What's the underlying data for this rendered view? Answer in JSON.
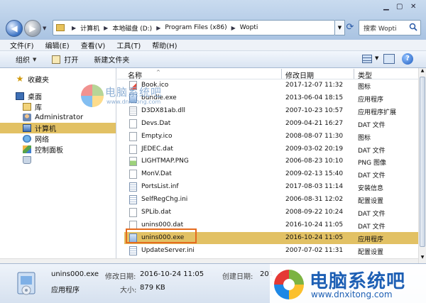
{
  "address": {
    "crumbs": [
      "计算机",
      "本地磁盘 (D:)",
      "Program Files (x86)",
      "Wopti"
    ]
  },
  "search": {
    "placeholder": "搜索 Wopti"
  },
  "menu": [
    "文件(F)",
    "编辑(E)",
    "查看(V)",
    "工具(T)",
    "帮助(H)"
  ],
  "toolbar": {
    "organize": "组织",
    "open": "打开",
    "new_folder": "新建文件夹"
  },
  "sidebar": {
    "favorites": "收藏夹",
    "desktop": "桌面",
    "library": "库",
    "user": "Administrator",
    "computer": "计算机",
    "network": "网络",
    "control_panel": "控制面板"
  },
  "columns": {
    "name": "名称",
    "date": "修改日期",
    "type": "类型"
  },
  "files": [
    {
      "name": "Book.ico",
      "date": "2017-12-07 11:32",
      "type": "图标",
      "icon": "ico"
    },
    {
      "name": "bundle.exe",
      "date": "2013-06-04 18:15",
      "type": "应用程序",
      "icon": "exe"
    },
    {
      "name": "D3DX81ab.dll",
      "date": "2007-10-23 10:57",
      "type": "应用程序扩展",
      "icon": "dll"
    },
    {
      "name": "Devs.Dat",
      "date": "2009-04-21 16:27",
      "type": "DAT 文件",
      "icon": "dat"
    },
    {
      "name": "Empty.ico",
      "date": "2008-08-07 11:30",
      "type": "图标",
      "icon": "blank"
    },
    {
      "name": "JEDEC.dat",
      "date": "2009-03-02 20:19",
      "type": "DAT 文件",
      "icon": "dat"
    },
    {
      "name": "LIGHTMAP.PNG",
      "date": "2006-08-23 10:10",
      "type": "PNG 图像",
      "icon": "png"
    },
    {
      "name": "MonV.Dat",
      "date": "2009-02-13 15:40",
      "type": "DAT 文件",
      "icon": "dat"
    },
    {
      "name": "PortsList.inf",
      "date": "2017-08-03 11:14",
      "type": "安装信息",
      "icon": "inf"
    },
    {
      "name": "SelfRegChg.ini",
      "date": "2006-08-31 12:02",
      "type": "配置设置",
      "icon": "ini"
    },
    {
      "name": "SPLib.dat",
      "date": "2008-09-22 10:24",
      "type": "DAT 文件",
      "icon": "dat"
    },
    {
      "name": "unins000.dat",
      "date": "2016-10-24 11:05",
      "type": "DAT 文件",
      "icon": "dat"
    },
    {
      "name": "unins000.exe",
      "date": "2016-10-24 11:05",
      "type": "应用程序",
      "icon": "exe",
      "selected": true
    },
    {
      "name": "UpdateServer.ini",
      "date": "2007-07-02 11:31",
      "type": "配置设置",
      "icon": "ini"
    }
  ],
  "details": {
    "name": "unins000.exe",
    "type": "应用程序",
    "modified_label": "修改日期:",
    "modified_value": "2016-10-24 11:05",
    "size_label": "大小:",
    "size_value": "879 KB",
    "created_label": "创建日期:",
    "created_value": "201"
  },
  "watermark": {
    "center_text": "电脑系统吧",
    "center_url": "www.dnxitong.com",
    "corner_text": "电脑系统吧",
    "corner_url": "www.dnxitong.com"
  },
  "colors": {
    "selection": "#e2c164",
    "highlight_box": "#e56b1f",
    "watermark_blue": "#1d5fb4"
  }
}
